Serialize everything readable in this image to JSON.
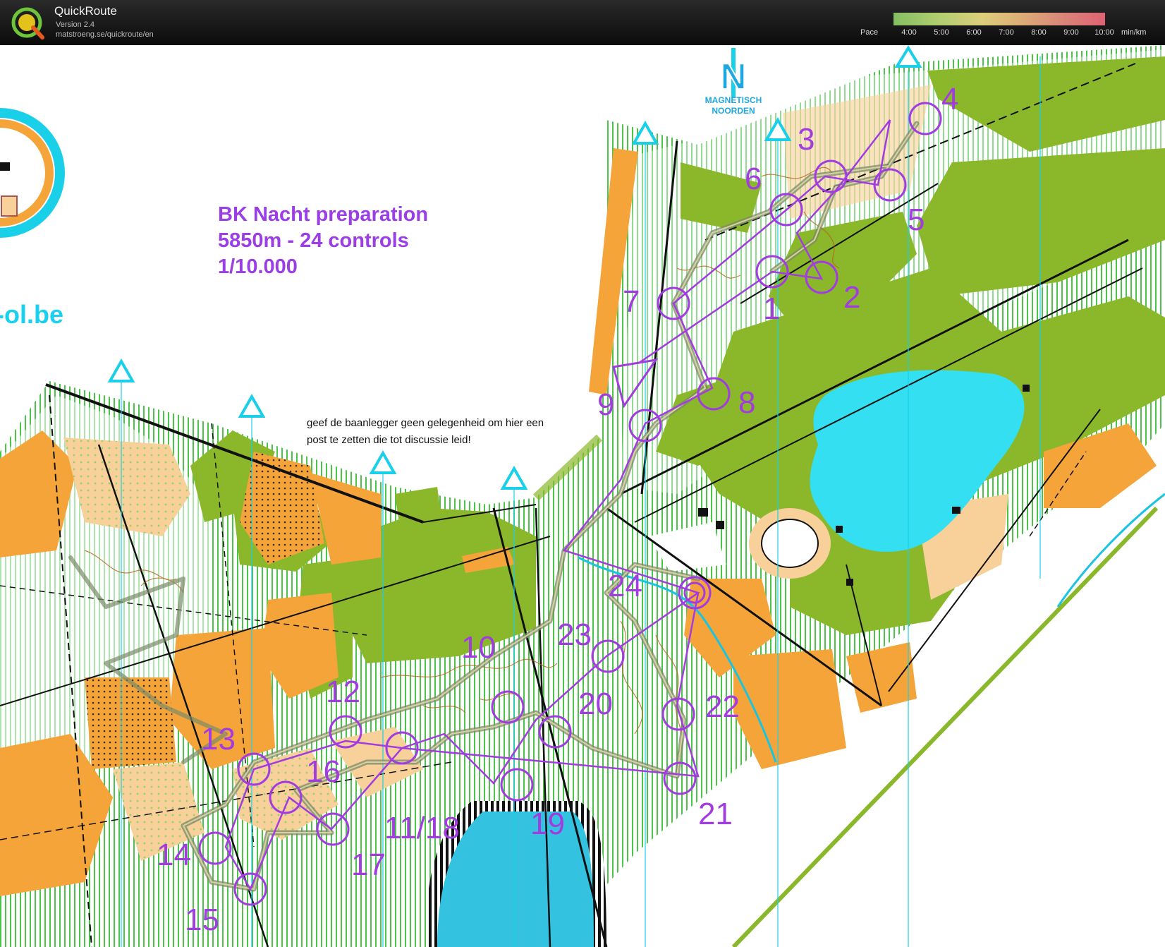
{
  "app": {
    "title": "QuickRoute",
    "version": "Version 2.4",
    "url": "matstroeng.se/quickroute/en"
  },
  "pace_legend": {
    "label": "Pace",
    "ticks": [
      "4:00",
      "5:00",
      "6:00",
      "7:00",
      "8:00",
      "9:00",
      "10:00"
    ],
    "unit": "min/km",
    "colors": [
      "#8fd16a",
      "#f2e186",
      "#f26a7c"
    ]
  },
  "map": {
    "title_lines": [
      "BK Nacht preparation",
      "5850m - 24 controls",
      "1/10.000"
    ],
    "note": "geef de baanlegger geen gelegenheid om hier een post te zetten die tot discussie leid!",
    "north_letter": "N",
    "north_label": "MAGNETISCH NOORDEN",
    "club_url": "-ol.be",
    "course_color": "#a23ce0",
    "controls": [
      "1",
      "2",
      "3",
      "4",
      "5",
      "6",
      "7",
      "8",
      "9",
      "10",
      "11/18",
      "12",
      "13",
      "14",
      "15",
      "16",
      "17",
      "19",
      "20",
      "21",
      "22",
      "23",
      "24"
    ]
  }
}
